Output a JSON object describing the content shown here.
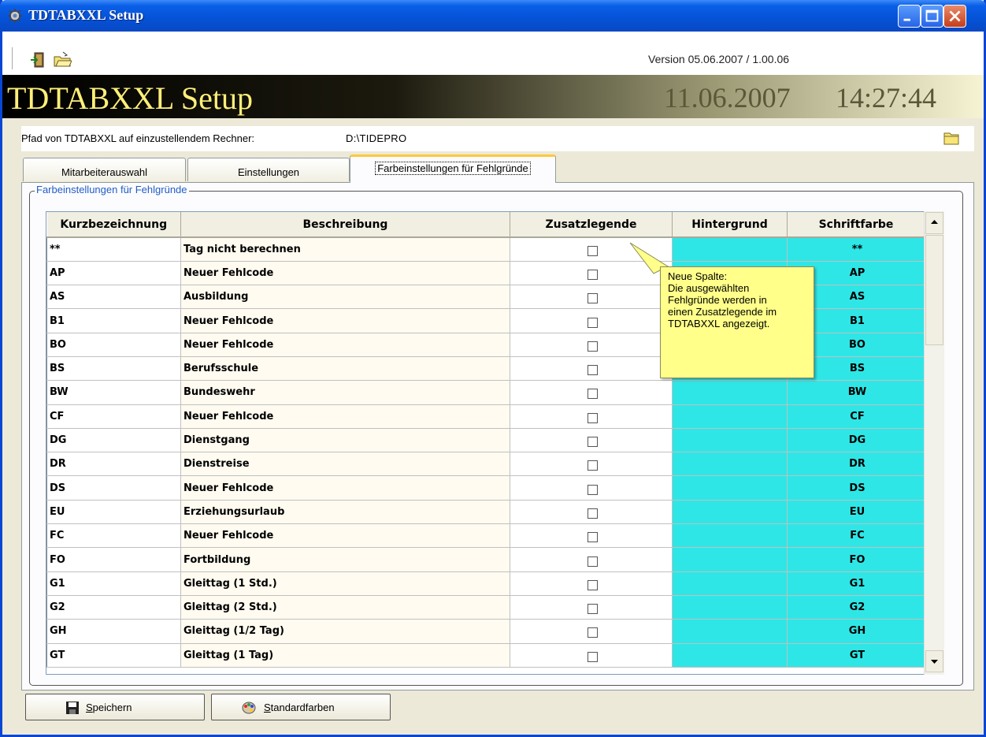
{
  "window": {
    "title": "TDTABXXL Setup"
  },
  "toolbar": {
    "version": "Version 05.06.2007 / 1.00.06"
  },
  "banner": {
    "title": "TDTABXXL Setup",
    "date": "11.06.2007",
    "time": "14:27:44"
  },
  "path": {
    "label": "Pfad von TDTABXXL auf einzustellendem Rechner:",
    "value": "D:\\TIDEPRO"
  },
  "tabs": [
    {
      "label": "Mitarbeiterauswahl",
      "active": false
    },
    {
      "label": "Einstellungen",
      "active": false
    },
    {
      "label": "Farbeinstellungen für Fehlgründe",
      "active": true
    }
  ],
  "group": {
    "legend": "Farbeinstellungen für Fehlgründe"
  },
  "grid": {
    "headers": [
      "Kurzbezeichnung",
      "Beschreibung",
      "Zusatzlegende",
      "Hintergrund",
      "Schriftfarbe"
    ],
    "rows": [
      {
        "code": "**",
        "desc": "Tag nicht berechnen",
        "checked": false,
        "fg": "**"
      },
      {
        "code": "AP",
        "desc": "Neuer Fehlcode",
        "checked": false,
        "fg": "AP"
      },
      {
        "code": "AS",
        "desc": "Ausbildung",
        "checked": false,
        "fg": "AS"
      },
      {
        "code": "B1",
        "desc": "Neuer Fehlcode",
        "checked": false,
        "fg": "B1"
      },
      {
        "code": "BO",
        "desc": "Neuer Fehlcode",
        "checked": false,
        "fg": "BO"
      },
      {
        "code": "BS",
        "desc": "Berufsschule",
        "checked": false,
        "fg": "BS"
      },
      {
        "code": "BW",
        "desc": "Bundeswehr",
        "checked": false,
        "fg": "BW"
      },
      {
        "code": "CF",
        "desc": "Neuer Fehlcode",
        "checked": false,
        "fg": "CF"
      },
      {
        "code": "DG",
        "desc": "Dienstgang",
        "checked": false,
        "fg": "DG"
      },
      {
        "code": "DR",
        "desc": "Dienstreise",
        "checked": false,
        "fg": "DR"
      },
      {
        "code": "DS",
        "desc": "Neuer Fehlcode",
        "checked": false,
        "fg": "DS"
      },
      {
        "code": "EU",
        "desc": "Erziehungsurlaub",
        "checked": false,
        "fg": "EU"
      },
      {
        "code": "FC",
        "desc": "Neuer Fehlcode",
        "checked": false,
        "fg": "FC"
      },
      {
        "code": "FO",
        "desc": "Fortbildung",
        "checked": false,
        "fg": "FO"
      },
      {
        "code": "G1",
        "desc": "Gleittag (1 Std.)",
        "checked": false,
        "fg": "G1"
      },
      {
        "code": "G2",
        "desc": "Gleittag (2 Std.)",
        "checked": false,
        "fg": "G2"
      },
      {
        "code": "GH",
        "desc": "Gleittag (1/2 Tag)",
        "checked": false,
        "fg": "GH"
      },
      {
        "code": "GT",
        "desc": "Gleittag (1 Tag)",
        "checked": false,
        "fg": "GT"
      }
    ],
    "cell_color": "#2fe6e6"
  },
  "tooltip": {
    "lines": [
      "Neue Spalte:",
      "Die ausgewählten",
      "Fehlgründe werden in",
      "einen Zusatzlegende im",
      "TDTABXXL angezeigt."
    ]
  },
  "buttons": {
    "save_accel": "S",
    "save_rest": "peichern",
    "std_accel": "S",
    "std_rest": "tandardfarben"
  },
  "icons": {
    "app": "gear-icon",
    "exit": "exit-door-icon",
    "open": "folder-open-icon",
    "folder": "folder-icon",
    "save": "floppy-disk-icon",
    "palette": "color-palette-icon"
  }
}
